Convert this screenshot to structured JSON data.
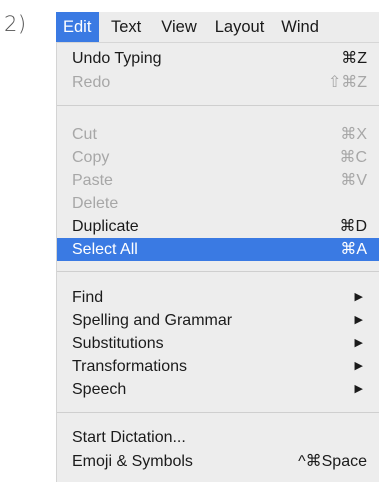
{
  "step_label": "2)",
  "menubar": {
    "items": [
      "Edit",
      "Text",
      "View",
      "Layout",
      "Wind"
    ]
  },
  "menu": {
    "group1": [
      {
        "label": "Undo Typing",
        "shortcut": "⌘Z"
      },
      {
        "label": "Redo",
        "shortcut": "⇧⌘Z"
      }
    ],
    "group2": [
      {
        "label": "Cut",
        "shortcut": "⌘X"
      },
      {
        "label": "Copy",
        "shortcut": "⌘C"
      },
      {
        "label": "Paste",
        "shortcut": "⌘V"
      },
      {
        "label": "Delete"
      },
      {
        "label": "Duplicate",
        "shortcut": "⌘D"
      },
      {
        "label": "Select All",
        "shortcut": "⌘A"
      }
    ],
    "group3": [
      {
        "label": "Find",
        "arrow": "▶"
      },
      {
        "label": "Spelling and Grammar",
        "arrow": "▶"
      },
      {
        "label": "Substitutions",
        "arrow": "▶"
      },
      {
        "label": "Transformations",
        "arrow": "▶"
      },
      {
        "label": "Speech",
        "arrow": "▶"
      }
    ],
    "group4": [
      {
        "label": "Start Dictation..."
      },
      {
        "label": "Emoji & Symbols",
        "shortcut": "^⌘Space"
      }
    ]
  },
  "colors": {
    "highlight": "#3a7ae3",
    "menu_background": "#ededed",
    "disabled_text": "#a7a7a7"
  }
}
